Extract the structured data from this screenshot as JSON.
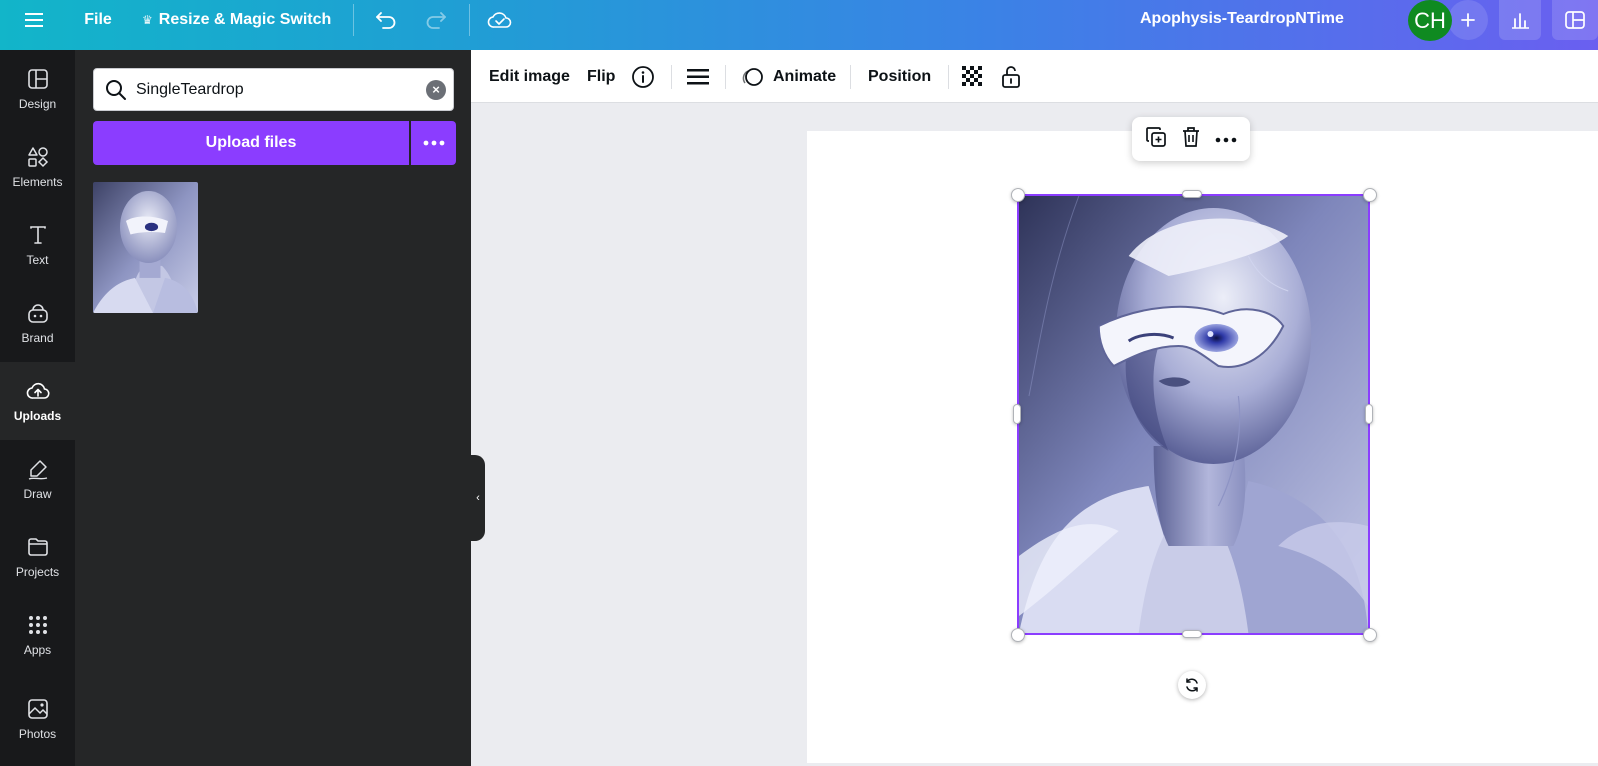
{
  "topbar": {
    "menu_icon": "hamburger-icon",
    "file_label": "File",
    "resize_label": "Resize & Magic Switch",
    "resize_icon": "crown-icon",
    "undo_icon": "undo-icon",
    "redo_icon": "redo-icon",
    "save_status_icon": "cloud-check-icon",
    "document_title": "Apophysis-TeardropNTime",
    "avatar_initials": "CH",
    "add_collaborator_icon": "plus-icon",
    "insights_icon": "bar-chart-icon",
    "share_icon": "share-icon",
    "gradient_start": "#12b5c9",
    "gradient_end": "#6a5ff0"
  },
  "rail": {
    "items": [
      {
        "label": "Design",
        "icon": "layout-icon"
      },
      {
        "label": "Elements",
        "icon": "shapes-icon"
      },
      {
        "label": "Text",
        "icon": "text-icon"
      },
      {
        "label": "Brand",
        "icon": "brand-icon"
      },
      {
        "label": "Uploads",
        "icon": "cloud-upload-icon"
      },
      {
        "label": "Draw",
        "icon": "pen-icon"
      },
      {
        "label": "Projects",
        "icon": "folder-icon"
      },
      {
        "label": "Apps",
        "icon": "apps-grid-icon"
      },
      {
        "label": "Photos",
        "icon": "image-icon"
      }
    ],
    "active": "Uploads"
  },
  "panel": {
    "search_value": "SingleTeardrop",
    "upload_button_label": "Upload files",
    "accent": "#8b3dff"
  },
  "context_toolbar": {
    "edit_image_label": "Edit image",
    "flip_label": "Flip",
    "info_icon": "info-icon",
    "border_style_icon": "lines-icon",
    "animate_label": "Animate",
    "position_label": "Position",
    "transparency_icon": "checkerboard-icon",
    "lock_icon": "lock-icon"
  },
  "floating_toolbar": {
    "duplicate_icon": "duplicate-icon",
    "delete_icon": "trash-icon",
    "more_icon": "more-dots-icon"
  },
  "canvas": {
    "selection_color": "#8b3dff",
    "rotate_icon": "rotate-icon"
  }
}
